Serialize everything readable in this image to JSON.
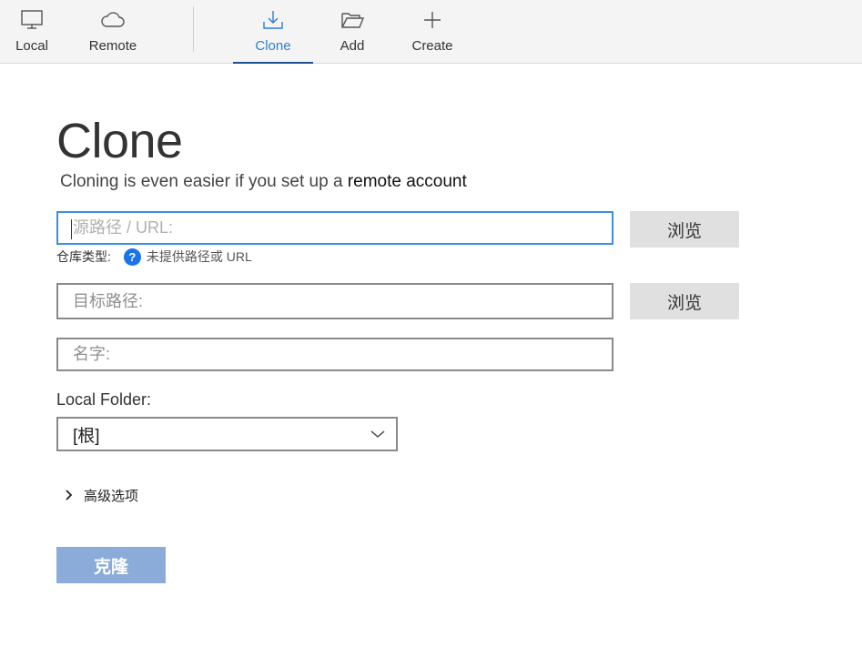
{
  "toolbar": {
    "items": [
      {
        "label": "Local",
        "icon": "monitor-icon"
      },
      {
        "label": "Remote",
        "icon": "cloud-icon"
      },
      {
        "label": "Clone",
        "icon": "download-icon",
        "active": true
      },
      {
        "label": "Add",
        "icon": "folder-open-icon"
      },
      {
        "label": "Create",
        "icon": "plus-icon"
      }
    ]
  },
  "main": {
    "title": "Clone",
    "subtitle_prefix": "Cloning is even easier if you set up a ",
    "subtitle_link": "remote account",
    "source": {
      "placeholder": "源路径 / URL:",
      "value": ""
    },
    "browse_label": "浏览",
    "repo_type_label": "仓库类型:",
    "repo_type_help": "?",
    "repo_type_message": "未提供路径或 URL",
    "destination": {
      "placeholder": "目标路径:",
      "value": ""
    },
    "name": {
      "placeholder": "名字:",
      "value": ""
    },
    "local_folder_label": "Local Folder:",
    "local_folder_value": "[根]",
    "advanced_label": "高级选项",
    "clone_button": "克隆"
  },
  "colors": {
    "accent": "#2d7fd3",
    "active_underline": "#1e4f91",
    "focus_border": "#3a8ee6",
    "help_badge": "#1a73e8",
    "clone_button_disabled": "#8bacd9"
  }
}
